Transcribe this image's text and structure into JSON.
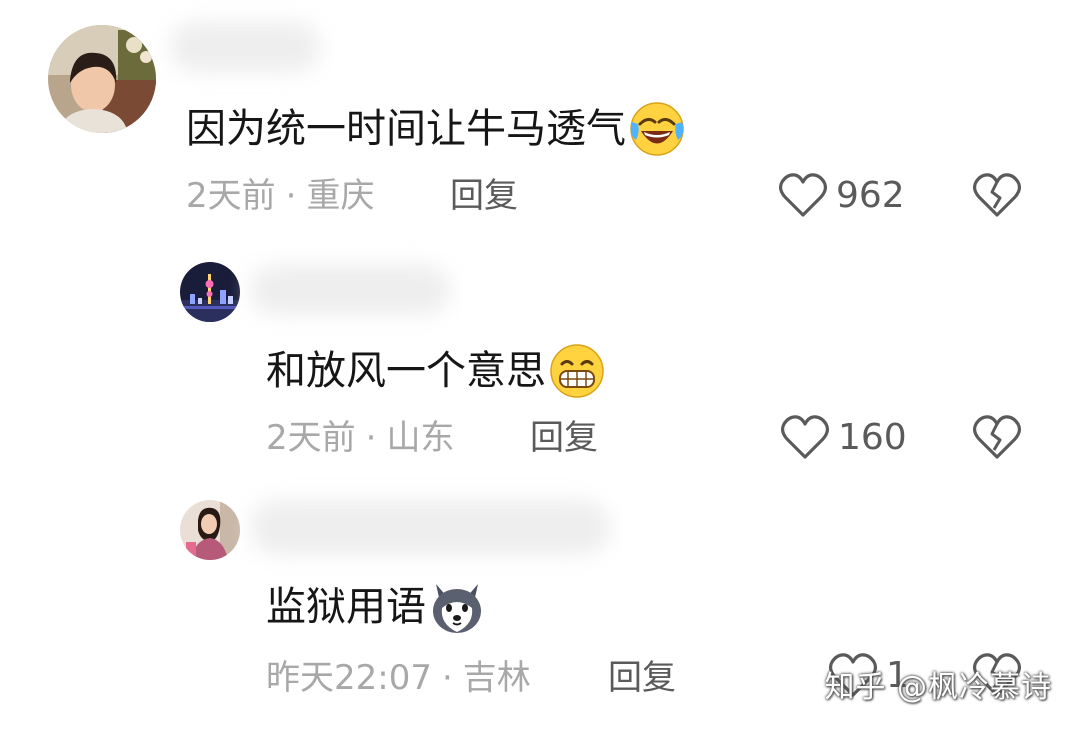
{
  "comments": [
    {
      "text": "因为统一时间让牛马透气",
      "emoji": "face-rolling-laughing",
      "time": "2天前",
      "location": "重庆",
      "reply_label": "回复",
      "likes": "962"
    },
    {
      "text": "和放风一个意思",
      "emoji": "grinning-teeth",
      "time": "2天前",
      "location": "山东",
      "reply_label": "回复",
      "likes": "160"
    },
    {
      "text": "监狱用语",
      "emoji": "husky-dog",
      "time": "昨天22:07",
      "location": "吉林",
      "reply_label": "回复",
      "likes": "1"
    }
  ],
  "separator": "·",
  "watermark": "知乎 @枫冷慕诗",
  "colors": {
    "text": "#161616",
    "meta": "#a8a8a8",
    "action": "#5a5a5a"
  }
}
